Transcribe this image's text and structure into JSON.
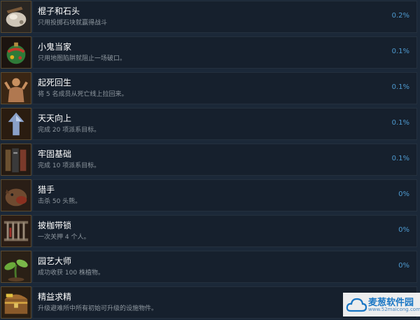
{
  "achievements": [
    {
      "icon": "rock-icon",
      "title": "棍子和石头",
      "desc": "只用投掷石块就赢得战斗",
      "percent": "0.2%"
    },
    {
      "icon": "ornament-bomb-icon",
      "title": "小鬼当家",
      "desc": "只用地图陷阱就阻止一场破口。",
      "percent": "0.1%"
    },
    {
      "icon": "revived-person-icon",
      "title": "起死回生",
      "desc": "将 5 名成员从死亡线上拉回来。",
      "percent": "0.1%"
    },
    {
      "icon": "up-arrow-icon",
      "title": "天天向上",
      "desc": "完成 20 项派系目标。",
      "percent": "0.1%"
    },
    {
      "icon": "book-pillar-icon",
      "title": "牢固基础",
      "desc": "完成 10 项派系目标。",
      "percent": "0.1%"
    },
    {
      "icon": "beast-head-icon",
      "title": "猎手",
      "desc": "击杀 50 头熊。",
      "percent": "0%"
    },
    {
      "icon": "cage-icon",
      "title": "披枷带锁",
      "desc": "一次关押 4 个人。",
      "percent": "0%"
    },
    {
      "icon": "sprout-icon",
      "title": "园艺大师",
      "desc": "成功收获 100 株植物。",
      "percent": "0%"
    },
    {
      "icon": "treasure-chest-icon",
      "title": "精益求精",
      "desc": "升级避难所中所有初始可升级的设施物件。",
      "percent": ""
    }
  ],
  "watermark": {
    "name": "麦葱软件园",
    "url": "www.52maicong.com"
  }
}
